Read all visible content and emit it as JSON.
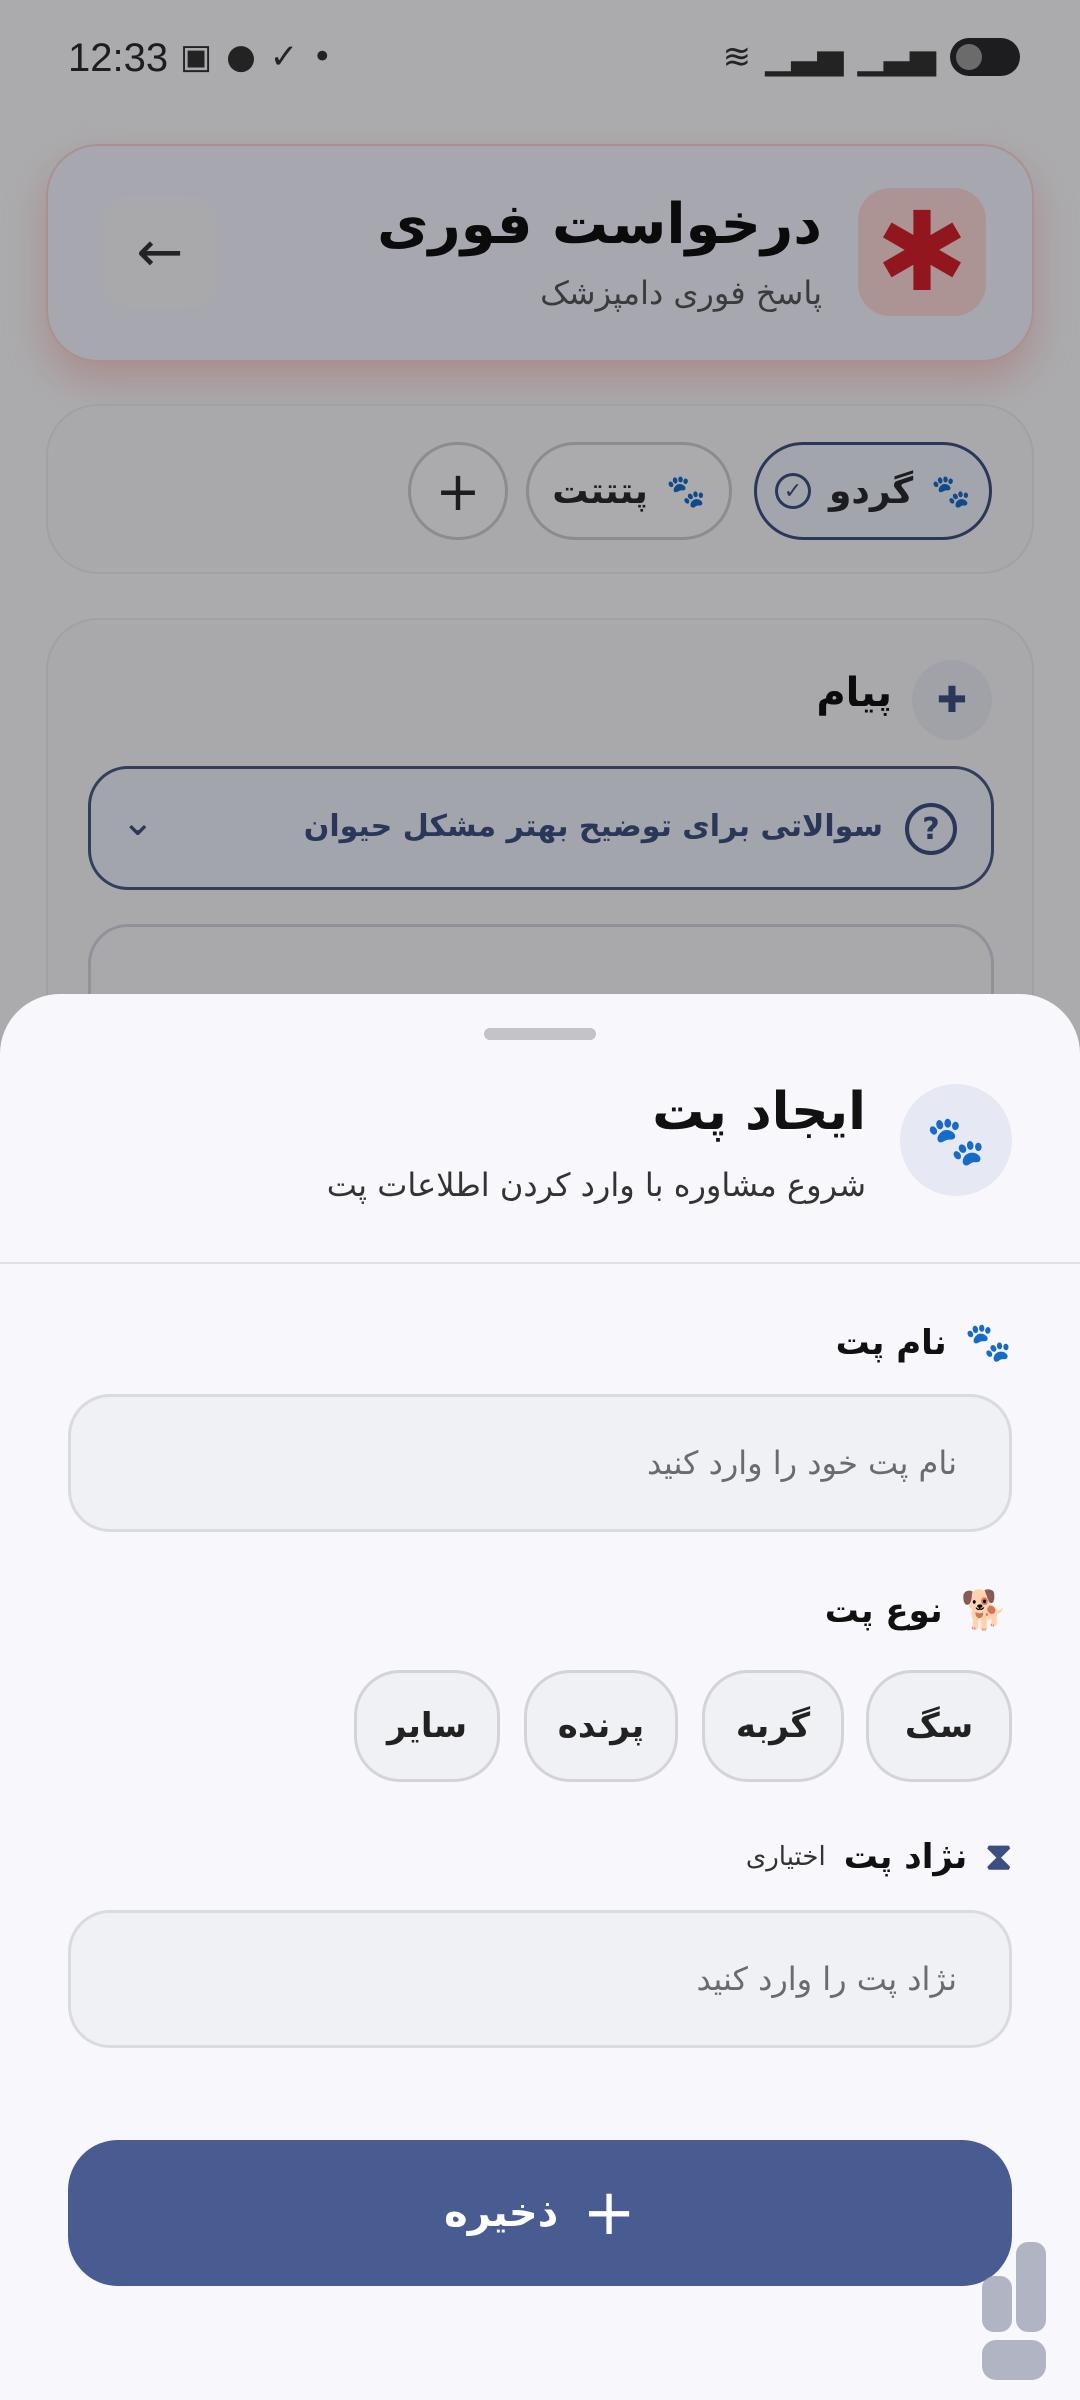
{
  "status_bar": {
    "time": "12:33",
    "icons_left": [
      "screenshot-icon",
      "chat-icon",
      "check-icon",
      "dot-icon"
    ],
    "icons_right": [
      "wifi-icon",
      "signal-icon",
      "signal-icon",
      "battery-icon"
    ]
  },
  "header": {
    "title": "درخواست فوری",
    "subtitle": "پاسخ فوری دامپزشک",
    "emergency_symbol": "✱",
    "back_arrow": "←"
  },
  "pets": {
    "items": [
      {
        "name": "گردو",
        "selected": true
      },
      {
        "name": "پتتتت",
        "selected": false
      }
    ],
    "add_symbol": "+"
  },
  "message": {
    "title": "پیام",
    "questions_label": "سوالاتی برای توضیح بهتر مشکل حیوان",
    "question_mark": "?",
    "chevron": "⌄"
  },
  "sheet": {
    "title": "ایجاد پت",
    "subtitle": "شروع مشاوره با وارد کردن اطلاعات پت",
    "name_field": {
      "label": "نام پت",
      "placeholder": "نام پت خود را وارد کنید"
    },
    "type_field": {
      "label": "نوع پت",
      "options": [
        "سگ",
        "گربه",
        "پرنده",
        "سایر"
      ]
    },
    "breed_field": {
      "label": "نژاد پت",
      "optional_tag": "اختیاری",
      "placeholder": "نژاد پت را وارد کنید"
    },
    "save_label": "ذخیره",
    "save_symbol": "+"
  },
  "colors": {
    "accent": "#495c91",
    "emergency": "#d0202c",
    "sheet_bg": "#f7f7fc"
  }
}
